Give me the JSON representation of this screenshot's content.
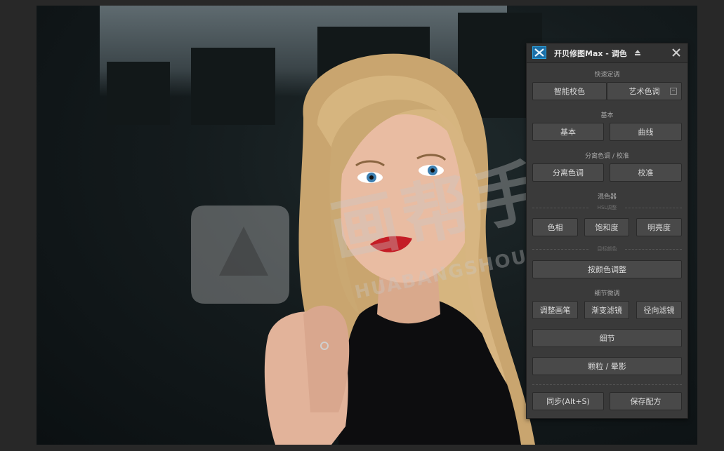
{
  "panel": {
    "title": "开贝修图Max - 调色",
    "quick_section": "快速定调",
    "quick_buttons": [
      "智能校色",
      "艺术色调"
    ],
    "basic_section": "基本",
    "basic_buttons": [
      "基本",
      "曲线"
    ],
    "split_section": "分离色调 / 校准",
    "split_buttons": [
      "分离色调",
      "校准"
    ],
    "mixer_section": "混色器",
    "hsl_sublabel": "HSL调整",
    "hsl_buttons": [
      "色相",
      "饱和度",
      "明亮度"
    ],
    "target_sublabel": "目标颜色",
    "color_adjust_button": "按颜色调整",
    "detail_section": "细节微调",
    "detail_buttons": [
      "调整画笔",
      "渐变滤镜",
      "径向滤镜"
    ],
    "detail_button": "细节",
    "grain_button": "颗粒 / 晕影",
    "sync_button": "同步(Alt+S)",
    "save_preset_button": "保存配方"
  },
  "watermark": {
    "cn_text": "画帮手",
    "en_text": "HUABANGSHOU.COM"
  },
  "colors": {
    "panel_bg": "#3a3a3a",
    "button_bg": "#494949",
    "logo_blue": "#2aa3e0"
  },
  "icons": {
    "logo": "kaibei-logo-icon",
    "pin": "pin-icon",
    "close": "close-icon",
    "save": "save-icon"
  }
}
